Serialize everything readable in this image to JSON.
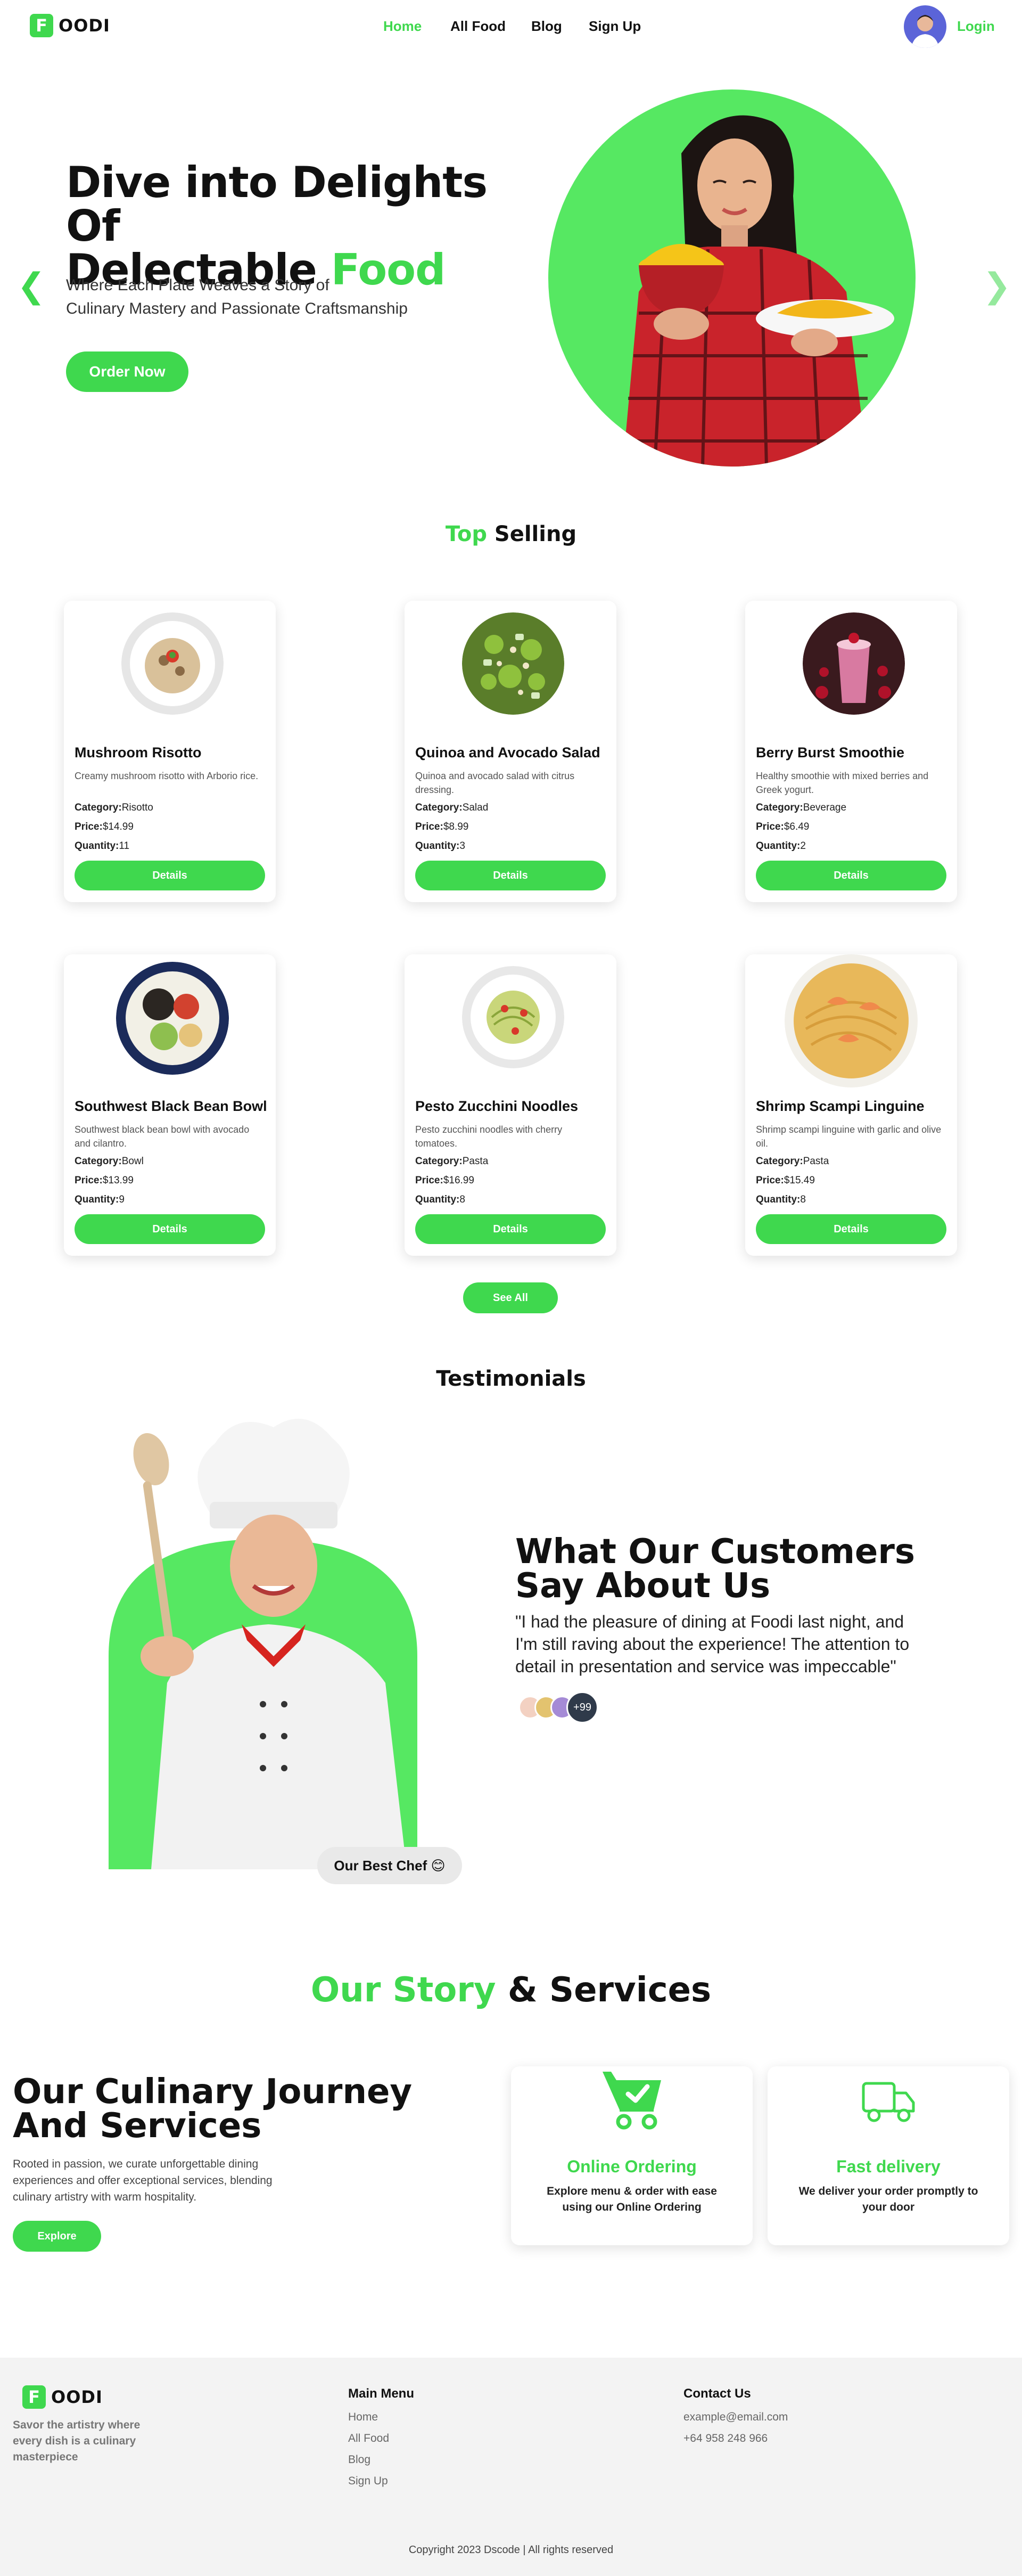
{
  "nav": {
    "logo_letter": "F",
    "logo_text": "OODI",
    "links": [
      "Home",
      "All Food",
      "Blog",
      "Sign Up"
    ],
    "login": "Login"
  },
  "hero": {
    "title_line1": "Dive into Delights Of",
    "title_line2_a": "Delectable ",
    "title_line2_b": "Food",
    "subtitle_line1": "Where Each Plate Weaves a Story of",
    "subtitle_line2": "Culinary Mastery and Passionate Craftsmanship",
    "button": "Order Now",
    "arrow_left": "❮",
    "arrow_right": "❯"
  },
  "top_selling": {
    "title_a": "Top",
    "title_b": " Selling",
    "labels": {
      "category": "Category:",
      "price": "Price:",
      "quantity": "Quantity:",
      "details": "Details"
    },
    "items": [
      {
        "name": "Mushroom Risotto",
        "desc": "Creamy mushroom risotto with Arborio rice.",
        "category": "Risotto",
        "price": "$14.99",
        "quantity": "11"
      },
      {
        "name": "Quinoa and Avocado Salad",
        "desc": "Quinoa and avocado salad with citrus dressing.",
        "category": "Salad",
        "price": "$8.99",
        "quantity": "3"
      },
      {
        "name": "Berry Burst Smoothie",
        "desc": "Healthy smoothie with mixed berries and Greek yogurt.",
        "category": "Beverage",
        "price": "$6.49",
        "quantity": "2"
      },
      {
        "name": "Southwest Black Bean Bowl",
        "desc": "Southwest black bean bowl with avocado and cilantro.",
        "category": "Bowl",
        "price": "$13.99",
        "quantity": "9"
      },
      {
        "name": "Pesto Zucchini Noodles",
        "desc": "Pesto zucchini noodles with cherry tomatoes.",
        "category": "Pasta",
        "price": "$16.99",
        "quantity": "8"
      },
      {
        "name": "Shrimp Scampi Linguine",
        "desc": "Shrimp scampi linguine with garlic and olive oil.",
        "category": "Pasta",
        "price": "$15.49",
        "quantity": "8"
      }
    ],
    "see_all": "See All"
  },
  "testimonials": {
    "section_title": "Testimonials",
    "title_line1": "What Our Customers",
    "title_line2": "Say About Us",
    "quote": "\"I had the pleasure of dining at Foodi last night, and I'm still raving about the experience! The attention to detail in presentation and service was impeccable\"",
    "more_count": "+99",
    "chef_badge": "Our Best Chef 😊"
  },
  "story": {
    "section_title_a": "Our Story",
    "section_title_b": " & Services",
    "title_line1": "Our Culinary Journey",
    "title_line2": "And Services",
    "text": "Rooted in passion, we curate unforgettable dining experiences and offer exceptional services, blending culinary artistry with warm hospitality.",
    "button": "Explore",
    "services": [
      {
        "title": "Online Ordering",
        "desc": "Explore menu & order with ease using our Online Ordering"
      },
      {
        "title": "Fast delivery",
        "desc": "We deliver your order promptly to your door"
      }
    ]
  },
  "footer": {
    "tagline": "Savor the artistry where every dish is a culinary masterpiece",
    "main_menu_title": "Main Menu",
    "main_menu": [
      "Home",
      "All Food",
      "Blog",
      "Sign Up"
    ],
    "contact_title": "Contact Us",
    "email": "example@email.com",
    "phone": "+64 958 248 966",
    "copyright": "Copyright 2023 Dscode | All rights reserved"
  },
  "colors": {
    "accent": "#3fd84e",
    "hero_circle": "#56e862",
    "footer_bg": "#f3f3f3"
  }
}
